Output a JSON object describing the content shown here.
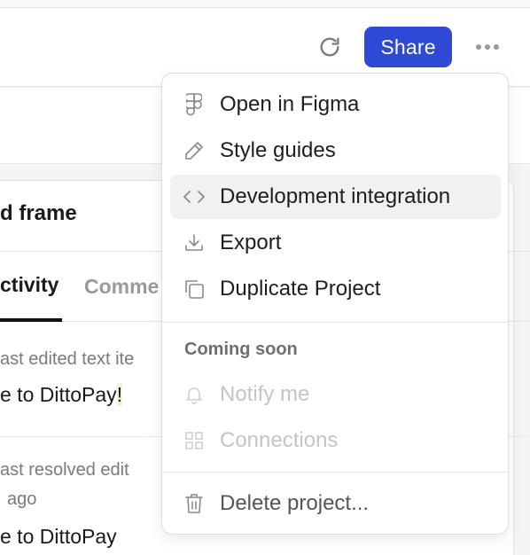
{
  "header": {
    "share_label": "Share"
  },
  "panel": {
    "title": "d frame",
    "tabs": [
      {
        "label": "ctivity"
      },
      {
        "label": "Comme"
      }
    ],
    "activity": [
      {
        "meta": "ast edited text ite",
        "text_before": "e to DittoPay",
        "text_highlight": "!"
      },
      {
        "meta": "ast resolved edit",
        "time": "ago",
        "text": "e to DittoPay"
      }
    ]
  },
  "menu": {
    "items": [
      {
        "label": "Open in Figma",
        "icon": "figma-icon"
      },
      {
        "label": "Style guides",
        "icon": "pencil-icon"
      },
      {
        "label": "Development integration",
        "icon": "code-icon"
      },
      {
        "label": "Export",
        "icon": "download-icon"
      },
      {
        "label": "Duplicate Project",
        "icon": "duplicate-icon"
      }
    ],
    "section_label": "Coming soon",
    "coming_soon": [
      {
        "label": "Notify me",
        "icon": "bell-icon"
      },
      {
        "label": "Connections",
        "icon": "grid-icon"
      }
    ],
    "danger": {
      "label": "Delete project...",
      "icon": "trash-icon"
    }
  },
  "colors": {
    "accent": "#2e49d6",
    "menu_hover": "#f1f1f1",
    "disabled_text": "#c4c4c4",
    "highlight": "#e9f8d8"
  }
}
